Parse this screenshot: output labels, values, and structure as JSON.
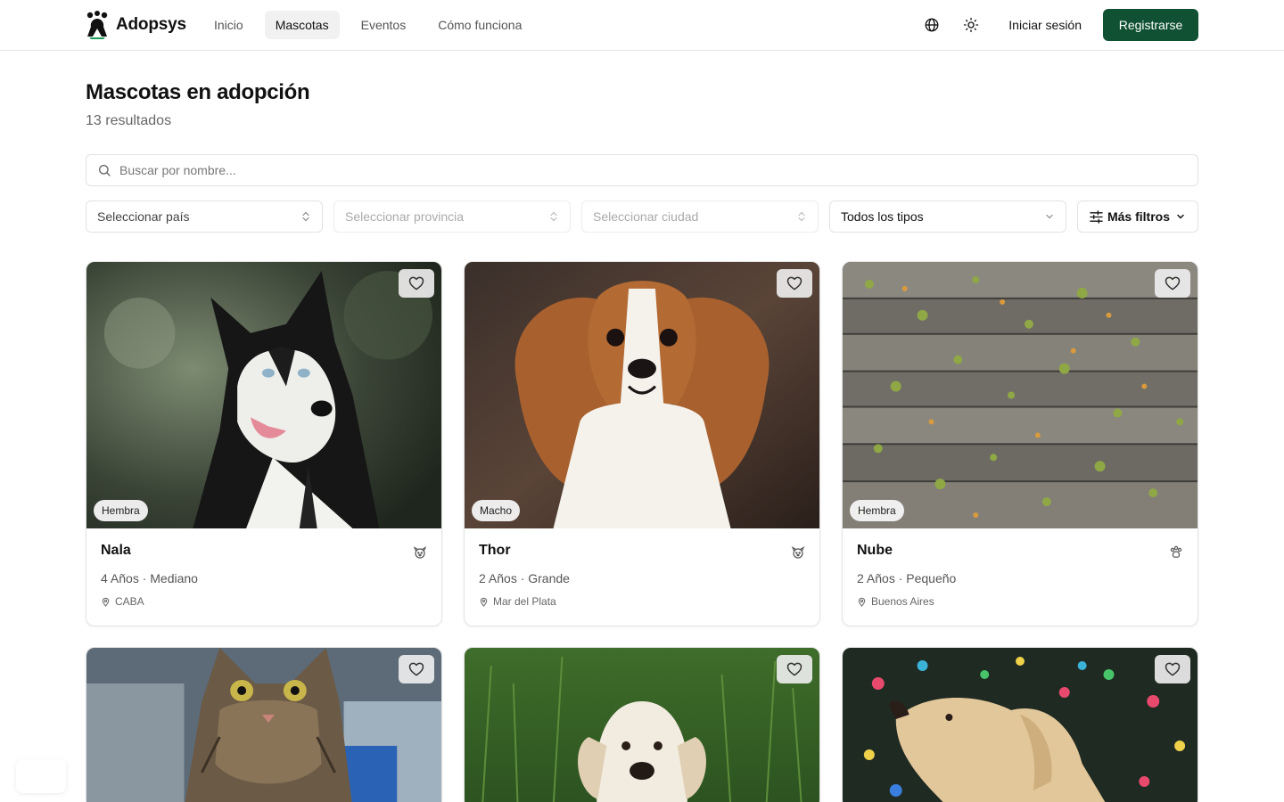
{
  "brand": {
    "name": "Adopsys",
    "accent": "#0f5132"
  },
  "nav": [
    {
      "label": "Inicio",
      "active": false
    },
    {
      "label": "Mascotas",
      "active": true
    },
    {
      "label": "Eventos",
      "active": false
    },
    {
      "label": "Cómo funciona",
      "active": false
    }
  ],
  "header": {
    "language_icon": "globe-icon",
    "theme_icon": "sun-icon",
    "login_label": "Iniciar sesión",
    "register_label": "Registrarse"
  },
  "page": {
    "title": "Mascotas en adopción",
    "result_count": "13 resultados"
  },
  "search": {
    "placeholder": "Buscar por nombre..."
  },
  "filters": {
    "country_placeholder": "Seleccionar país",
    "province_placeholder": "Seleccionar provincia",
    "city_placeholder": "Seleccionar ciudad",
    "type_value": "Todos los tipos",
    "more_label": "Más filtros"
  },
  "pets": [
    {
      "name": "Nala",
      "sex": "Hembra",
      "meta": "4 Años · Mediano",
      "location": "CABA",
      "species_icon": "dog-icon"
    },
    {
      "name": "Thor",
      "sex": "Macho",
      "meta": "2 Años · Grande",
      "location": "Mar del Plata",
      "species_icon": "dog-icon"
    },
    {
      "name": "Nube",
      "sex": "Hembra",
      "meta": "2 Años · Pequeño",
      "location": "Buenos Aires",
      "species_icon": "paw-icon"
    },
    {
      "name": "",
      "sex": "",
      "meta": "",
      "location": "",
      "species_icon": "cat-icon"
    },
    {
      "name": "",
      "sex": "",
      "meta": "",
      "location": "",
      "species_icon": "dog-icon"
    },
    {
      "name": "",
      "sex": "",
      "meta": "",
      "location": "",
      "species_icon": "dog-icon"
    }
  ]
}
